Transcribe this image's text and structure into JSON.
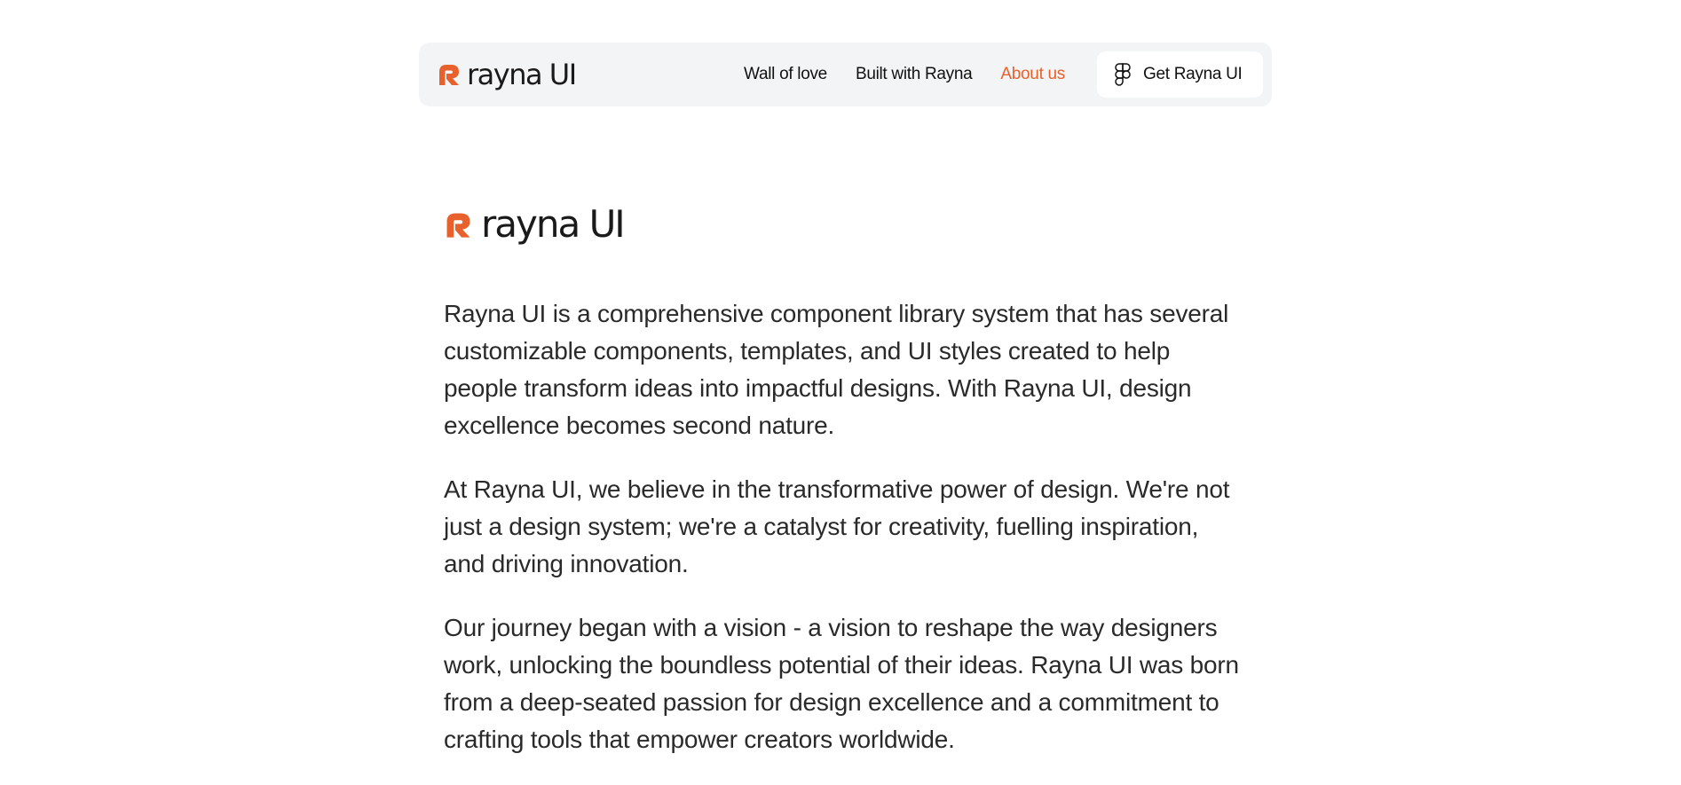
{
  "brand": {
    "name": "rayna UI",
    "accent_color": "#e8612c"
  },
  "nav": {
    "links": [
      {
        "label": "Wall of love"
      },
      {
        "label": "Built with Rayna"
      },
      {
        "label": "About us",
        "active": true
      }
    ],
    "cta": {
      "label": "Get Rayna UI",
      "icon": "figma-icon"
    }
  },
  "content": {
    "paragraphs": [
      "Rayna UI is a comprehensive component library system that has several customizable components, templates, and UI styles created to help people transform ideas into impactful designs. With Rayna UI, design excellence becomes second nature.",
      "At Rayna UI, we believe in the transformative power of design. We're not just a design system; we're a catalyst for creativity, fuelling inspiration, and driving innovation.",
      "Our journey began with a vision - a vision to reshape the way designers work, unlocking the boundless potential of their ideas. Rayna UI was born from a deep-seated passion for design excellence and a commitment to crafting tools that empower creators worldwide."
    ]
  }
}
